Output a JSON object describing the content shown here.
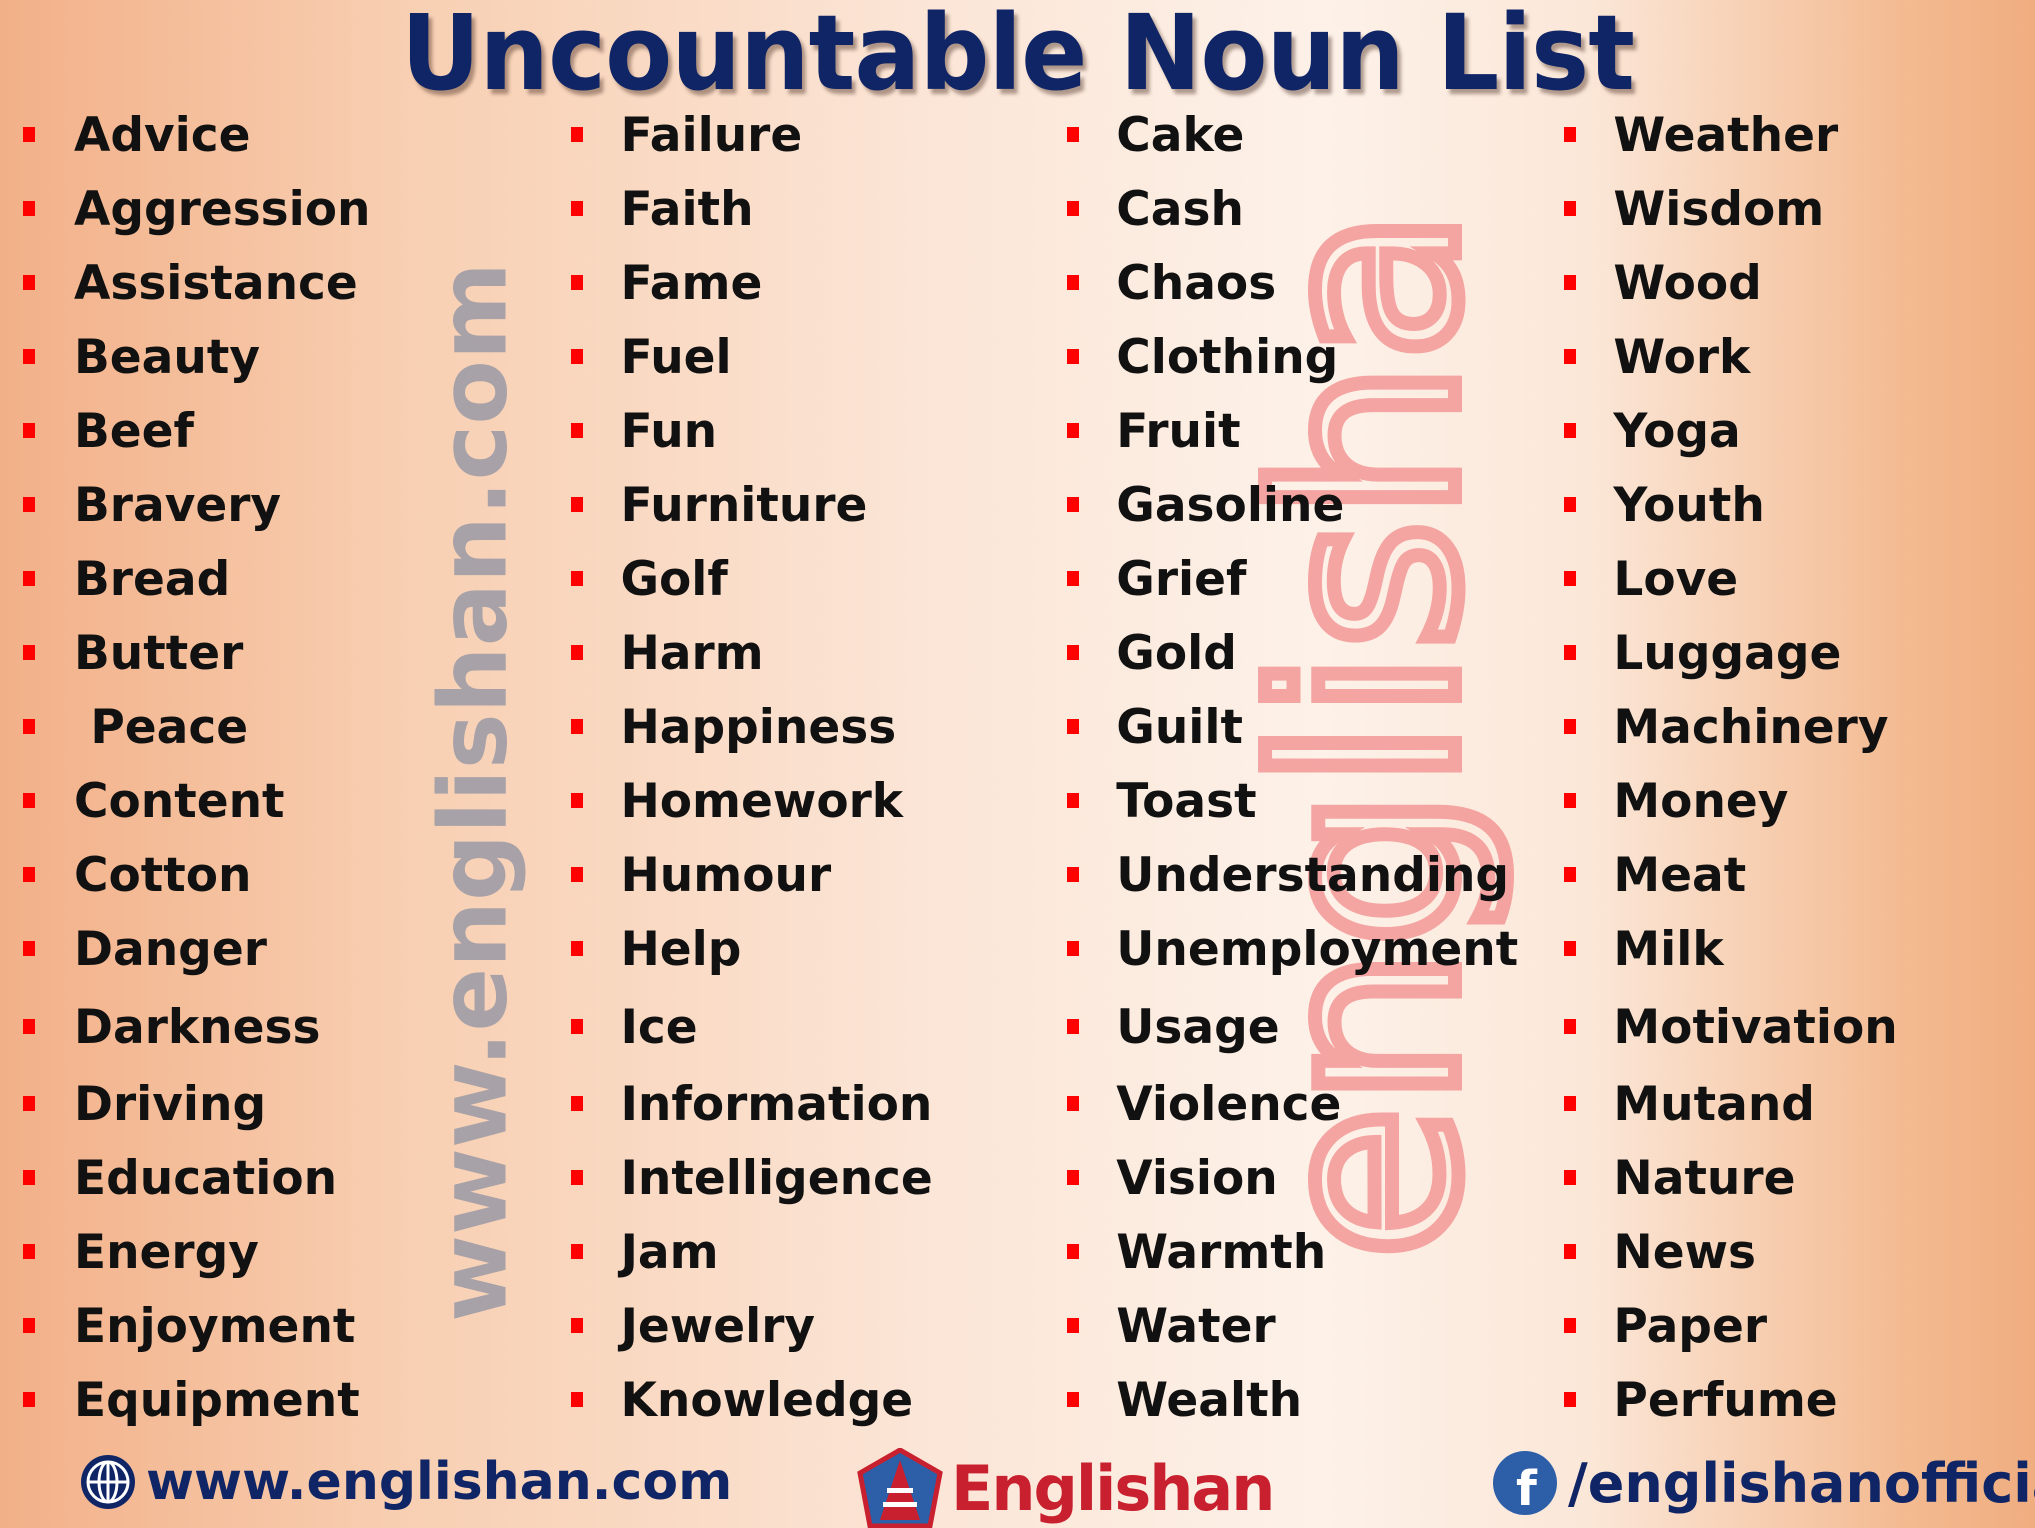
{
  "title": "Uncountable Noun List",
  "colors": {
    "title": "#0f2566",
    "bullet": "#ff0000",
    "text": "#111111",
    "brand_red": "#c8202e",
    "brand_blue": "#2d5fa8"
  },
  "columns": [
    [
      "Advice",
      "Aggression",
      "Assistance",
      "Beauty",
      "Beef",
      "Bravery",
      "Bread",
      "Butter",
      " Peace",
      "Content",
      "Cotton",
      "Danger",
      "Darkness",
      "Driving",
      "Education",
      "Energy",
      "Enjoyment",
      "Equipment"
    ],
    [
      "Failure",
      "Faith",
      "Fame",
      "Fuel",
      "Fun",
      "Furniture",
      "Golf",
      "Harm",
      "Happiness",
      "Homework",
      "Humour",
      "Help",
      "Ice",
      "Information",
      "Intelligence",
      "Jam",
      "Jewelry",
      "Knowledge"
    ],
    [
      "Cake",
      "Cash",
      "Chaos",
      "Clothing",
      "Fruit",
      "Gasoline",
      "Grief",
      "Gold",
      "Guilt",
      "Toast",
      "Understanding",
      "Unemployment",
      "Usage",
      "Violence",
      "Vision",
      "Warmth",
      "Water",
      "Wealth"
    ],
    [
      "Weather",
      "Wisdom",
      "Wood",
      "Work",
      "Yoga",
      "Youth",
      "Love",
      "Luggage",
      "Machinery",
      "Money",
      "Meat",
      "Milk",
      "Motivation",
      "Mutand",
      "Nature",
      "News",
      "Paper",
      "Perfume"
    ]
  ],
  "watermark_url": "www.englishan.com",
  "watermark_logo": "englishan",
  "footer": {
    "website": "www.englishan.com",
    "website_icon": "globe-icon",
    "brand": "Englishan",
    "facebook": "/englishanofficial",
    "facebook_icon": "facebook-icon"
  }
}
